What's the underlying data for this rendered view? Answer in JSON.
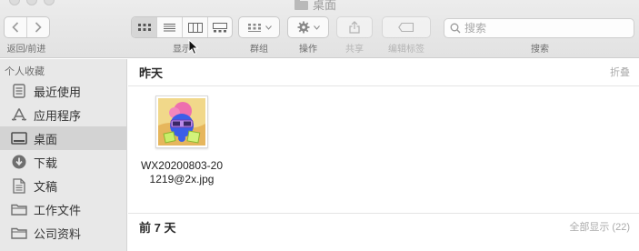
{
  "window": {
    "title": "桌面"
  },
  "toolbar": {
    "back_forward_label": "返回/前进",
    "view_label": "显示",
    "group_label": "群组",
    "action_label": "操作",
    "share_label": "共享",
    "edit_tags_label": "编辑标签",
    "search_label": "搜索",
    "search_placeholder": "搜索",
    "active_view": "icon"
  },
  "sidebar": {
    "header": "个人收藏",
    "items": [
      {
        "label": "最近使用",
        "icon": "recents-icon",
        "selected": false
      },
      {
        "label": "应用程序",
        "icon": "applications-icon",
        "selected": false
      },
      {
        "label": "桌面",
        "icon": "desktop-icon",
        "selected": true
      },
      {
        "label": "下载",
        "icon": "downloads-icon",
        "selected": false
      },
      {
        "label": "文稿",
        "icon": "documents-icon",
        "selected": false
      },
      {
        "label": "工作文件",
        "icon": "folder-icon",
        "selected": false
      },
      {
        "label": "公司资料",
        "icon": "folder-icon",
        "selected": false
      }
    ]
  },
  "main": {
    "sections": [
      {
        "title": "昨天",
        "action": "折叠",
        "files": [
          {
            "name_line1": "WX20200803-20",
            "name_line2": "1219@2x.jpg"
          }
        ]
      },
      {
        "title": "前 7 天",
        "action": "全部显示 (22)"
      }
    ]
  },
  "colors": {
    "selection_gray": "#d3d3d3",
    "sidebar_bg": "#e8e8e8",
    "toolbar_bg": "#e5e5e5"
  }
}
